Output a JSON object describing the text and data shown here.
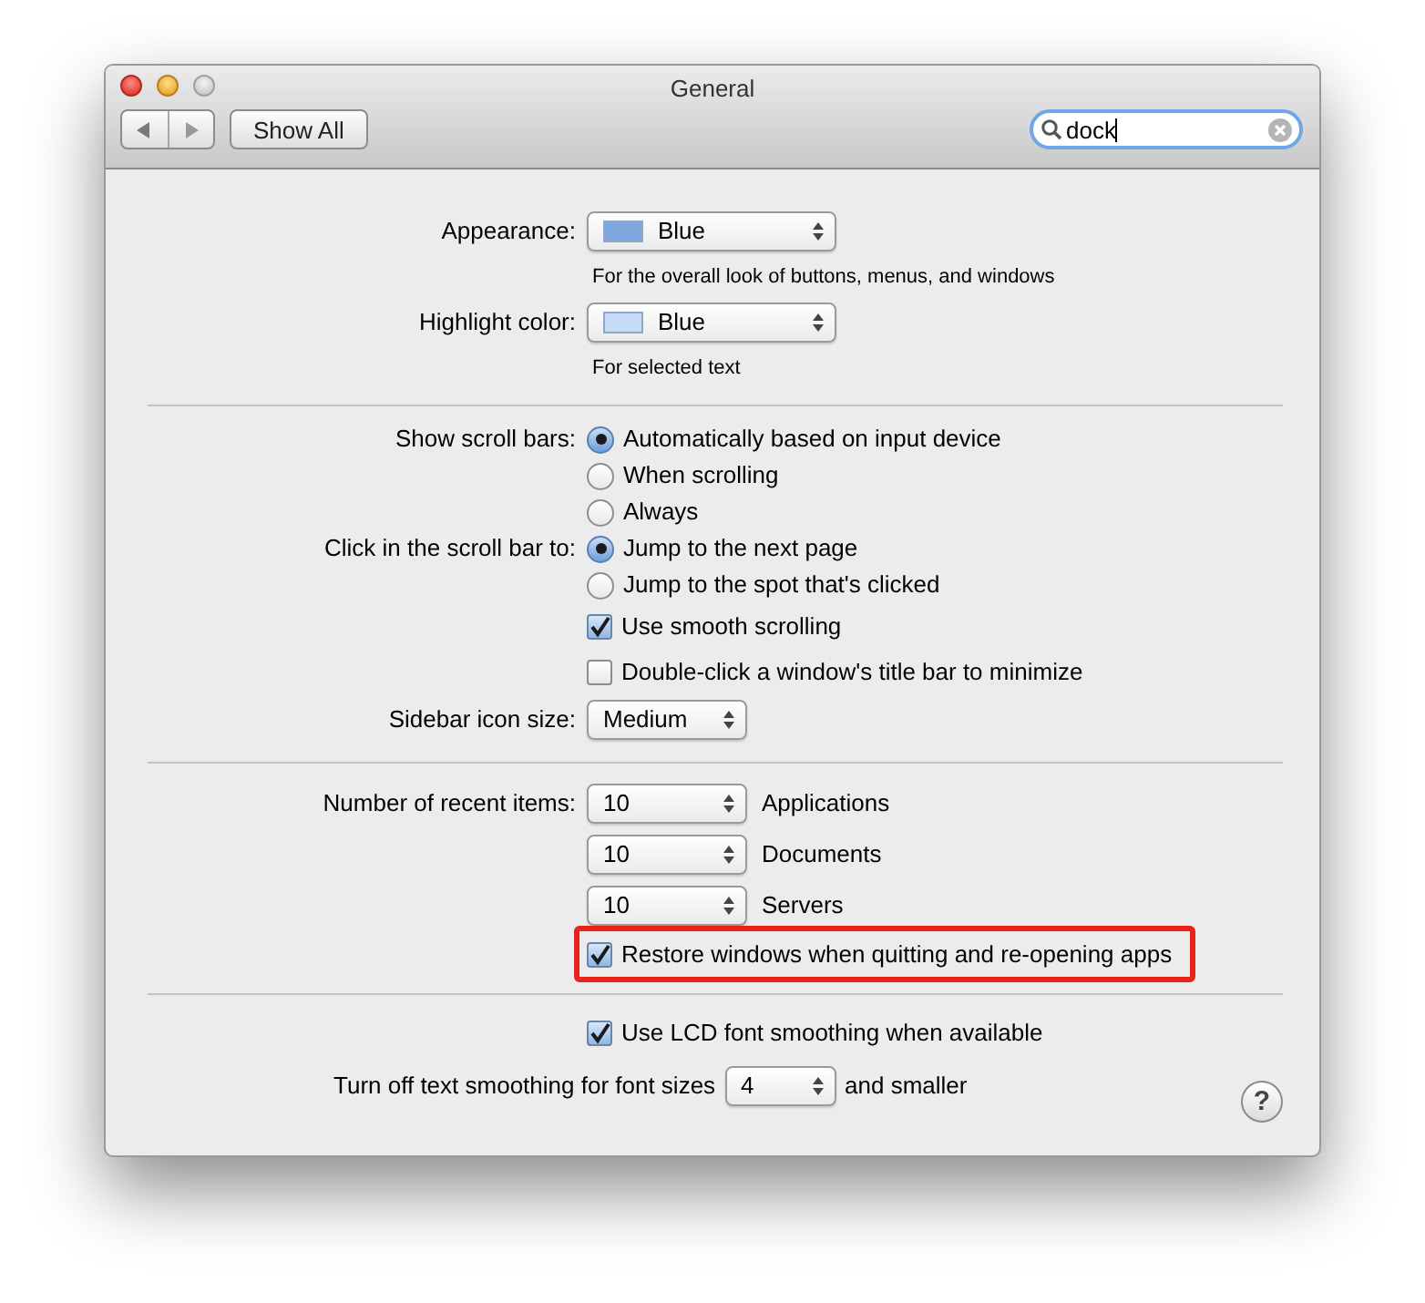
{
  "window": {
    "title": "General"
  },
  "toolbar": {
    "show_all": "Show All",
    "search": {
      "value": "dock"
    }
  },
  "rows": [
    {
      "kind": "popup",
      "label": "Appearance:",
      "value": "Blue",
      "color": "#7ea6de"
    },
    {
      "kind": "hint",
      "text": "For the overall look of buttons, menus, and windows"
    },
    {
      "kind": "popup",
      "label": "Highlight color:",
      "value": "Blue",
      "color": "#c5dcf8"
    },
    {
      "kind": "hint",
      "text": "For selected text"
    },
    {
      "kind": "divider"
    },
    {
      "kind": "radio",
      "label": "Show scroll bars:",
      "text": "Automatically based on input device",
      "selected": true
    },
    {
      "kind": "radio",
      "text": "When scrolling",
      "selected": false
    },
    {
      "kind": "radio",
      "text": "Always",
      "selected": false
    },
    {
      "kind": "radio",
      "label": "Click in the scroll bar to:",
      "text": "Jump to the next page",
      "selected": true
    },
    {
      "kind": "radio",
      "text": "Jump to the spot that's clicked",
      "selected": false
    },
    {
      "kind": "checkbox",
      "text": "Use smooth scrolling",
      "checked": true,
      "highlighted": false
    },
    {
      "kind": "checkbox",
      "text": "Double-click a window's title bar to minimize",
      "checked": false,
      "highlighted": false
    },
    {
      "kind": "popup",
      "label": "Sidebar icon size:",
      "value": "Medium"
    },
    {
      "kind": "divider"
    },
    {
      "kind": "popup",
      "label": "Number of recent items:",
      "value": "10",
      "suffix": "Applications"
    },
    {
      "kind": "popup",
      "value": "10",
      "suffix": "Documents"
    },
    {
      "kind": "popup",
      "value": "10",
      "suffix": "Servers"
    },
    {
      "kind": "checkbox",
      "text": "Restore windows when quitting and re-opening apps",
      "checked": true,
      "highlighted": true
    },
    {
      "kind": "divider"
    },
    {
      "kind": "checkbox",
      "text": "Use LCD font smoothing when available",
      "checked": true,
      "highlighted": false
    },
    {
      "kind": "inline-popup",
      "prefix": "Turn off text smoothing for font sizes",
      "value": "4",
      "suffix": "and smaller"
    }
  ],
  "help_button": "?"
}
